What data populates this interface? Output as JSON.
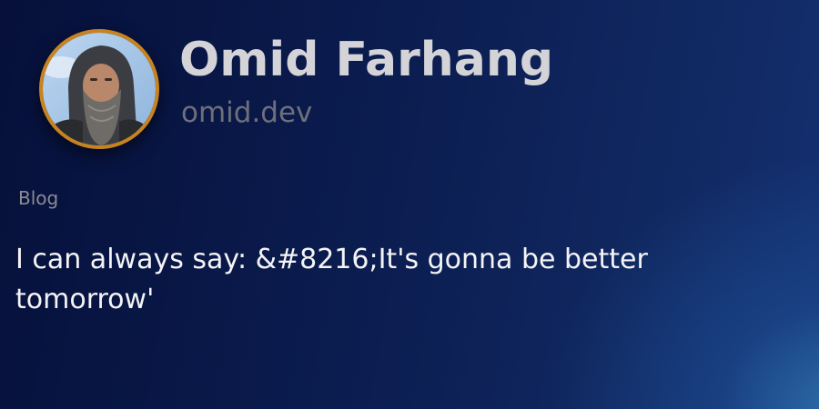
{
  "profile": {
    "name": "Omid Farhang",
    "domain": "omid.dev"
  },
  "post": {
    "category": "Blog",
    "title": "I can always say: &#8216;It's gonna be better tomorrow'"
  },
  "colors": {
    "avatar_border": "#c8831f",
    "name_text": "#d4d4d8",
    "domain_text": "#6e6f7a",
    "category_text": "#8a8b94",
    "title_text": "#f4f4f6"
  }
}
